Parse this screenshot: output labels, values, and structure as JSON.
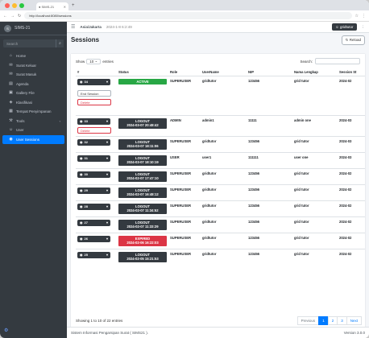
{
  "browser": {
    "tab_title": "SIMS-21",
    "url": "http://localhost:8080/sessions"
  },
  "sidebar": {
    "brand": "SIMS-21",
    "search_placeholder": "Search",
    "items": [
      {
        "label": "Home",
        "icon": "home-icon"
      },
      {
        "label": "Surat Keluar",
        "icon": "mail-out-icon"
      },
      {
        "label": "Surat Masuk",
        "icon": "mail-in-icon"
      },
      {
        "label": "Agenda",
        "icon": "agenda-icon"
      },
      {
        "label": "Gallery File",
        "icon": "image-icon"
      },
      {
        "label": "Klasifikasi",
        "icon": "tag-icon"
      },
      {
        "label": "Tempat Penyimpanan",
        "icon": "archive-icon"
      },
      {
        "label": "Tools",
        "icon": "wrench-icon"
      },
      {
        "label": "User",
        "icon": "user-icon"
      },
      {
        "label": "User Sessions",
        "icon": "session-icon"
      }
    ]
  },
  "topnav": {
    "title": "Asia/Jakarta",
    "datetime": "2024-1-8 6:2:49",
    "user": "gridtutor"
  },
  "page": {
    "title": "Sessions",
    "reload_label": "Reload"
  },
  "table": {
    "show_label": "Show",
    "entries_value": "10",
    "entries_label": "entries",
    "search_label": "Search:",
    "headers": [
      "#",
      "Status",
      "Role",
      "UserName",
      "NIP",
      "Nama Lengkap",
      "Session St"
    ],
    "rows": [
      {
        "id": "34",
        "status": "ACTIVE",
        "status_time": "",
        "kind": "green",
        "role": "SUPERUSER",
        "username": "gridtutor",
        "nip": "123456",
        "name": "grid tutor",
        "start": "2024-02"
      },
      {
        "id": "33",
        "status": "LOGOUT",
        "status_time": "2024-03-07 20:48:42",
        "kind": "dark",
        "role": "ADMIN",
        "username": "admin1",
        "nip": "11111",
        "name": "admin one",
        "start": "2024-03"
      },
      {
        "id": "32",
        "status": "LOGOUT",
        "status_time": "2024-03-07 18:11:06",
        "kind": "dark",
        "role": "SUPERUSER",
        "username": "gridtutor",
        "nip": "123456",
        "name": "grid tutor",
        "start": "2024-03"
      },
      {
        "id": "31",
        "status": "LOGOUT",
        "status_time": "2024-03-07 18:10:19",
        "kind": "dark",
        "role": "USER",
        "username": "user1",
        "nip": "111111",
        "name": "user one",
        "start": "2024-03"
      },
      {
        "id": "30",
        "status": "LOGOUT",
        "status_time": "2024-02-07 17:47:10",
        "kind": "dark",
        "role": "SUPERUSER",
        "username": "gridtutor",
        "nip": "123456",
        "name": "grid tutor",
        "start": "2024-02"
      },
      {
        "id": "29",
        "status": "LOGOUT",
        "status_time": "2024-02-07 16:48:12",
        "kind": "dark",
        "role": "SUPERUSER",
        "username": "gridtutor",
        "nip": "123456",
        "name": "grid tutor",
        "start": "2024-02"
      },
      {
        "id": "28",
        "status": "LOGOUT",
        "status_time": "2024-02-07 11:34:52",
        "kind": "dark",
        "role": "SUPERUSER",
        "username": "gridtutor",
        "nip": "123456",
        "name": "grid tutor",
        "start": "2024-02"
      },
      {
        "id": "27",
        "status": "LOGOUT",
        "status_time": "2024-02-07 11:33:29",
        "kind": "dark",
        "role": "SUPERUSER",
        "username": "gridtutor",
        "nip": "123456",
        "name": "grid tutor",
        "start": "2024-02"
      },
      {
        "id": "26",
        "status": "EXPIRED",
        "status_time": "2024-02-06 16:22:03",
        "kind": "red",
        "role": "SUPERUSER",
        "username": "gridtutor",
        "nip": "123456",
        "name": "grid tutor",
        "start": "2024-02"
      },
      {
        "id": "25",
        "status": "LOGOUT",
        "status_time": "2024-02-05 15:21:53",
        "kind": "dark",
        "role": "SUPERUSER",
        "username": "gridtutor",
        "nip": "123456",
        "name": "grid tutor",
        "start": "2024-02"
      }
    ],
    "row_actions": [
      "End Session",
      "Delete"
    ],
    "info": "Showing 1 to 10 of 22 entries",
    "pager": [
      "Previous",
      "1",
      "2",
      "3",
      "Next"
    ]
  },
  "footer": {
    "left": "Sistem Informasi Pengarsipan Surat ( SIMS21 ).",
    "right": "Version 3.0.0"
  },
  "colors": {
    "sidebar": "#343a40",
    "active": "#007bff",
    "green": "#28a745",
    "red": "#dc3545"
  }
}
